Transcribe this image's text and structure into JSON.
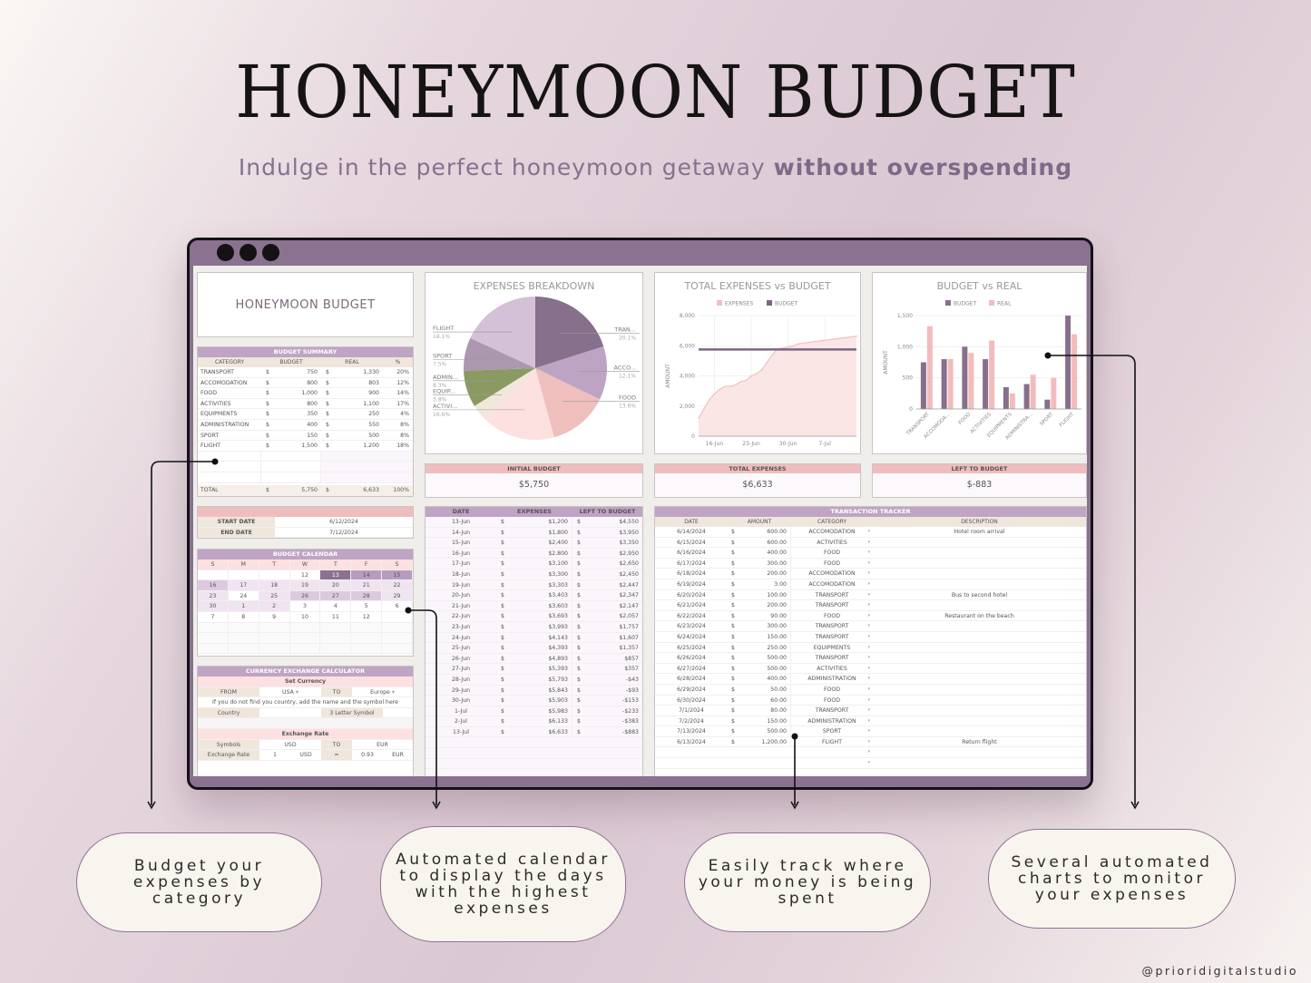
{
  "header": {
    "title": "HONEYMOON BUDGET",
    "subtitle_regular": "Indulge in the perfect honeymoon getaway ",
    "subtitle_bold": "without overspending"
  },
  "sheet": {
    "app_title": "HONEYMOON BUDGET",
    "budget_summary": {
      "title": "BUDGET SUMMARY",
      "columns": [
        "CATEGORY",
        "BUDGET",
        "REAL",
        "%"
      ],
      "currency": "$",
      "rows": [
        {
          "category": "TRANSPORT",
          "budget": "750",
          "real": "1,330",
          "pct": "20%"
        },
        {
          "category": "ACCOMODATION",
          "budget": "800",
          "real": "803",
          "pct": "12%"
        },
        {
          "category": "FOOD",
          "budget": "1,000",
          "real": "900",
          "pct": "14%"
        },
        {
          "category": "ACTIVITIES",
          "budget": "800",
          "real": "1,100",
          "pct": "17%"
        },
        {
          "category": "EQUIPMENTS",
          "budget": "350",
          "real": "250",
          "pct": "4%"
        },
        {
          "category": "ADMINISTRATION",
          "budget": "400",
          "real": "550",
          "pct": "8%"
        },
        {
          "category": "SPORT",
          "budget": "150",
          "real": "500",
          "pct": "8%"
        },
        {
          "category": "FLIGHT",
          "budget": "1,500",
          "real": "1,200",
          "pct": "18%"
        }
      ],
      "total": {
        "label": "TOTAL",
        "budget": "5,750",
        "real": "6,633",
        "pct": "100%"
      }
    },
    "dates": {
      "start_label": "START DATE",
      "start_value": "6/12/2024",
      "end_label": "END DATE",
      "end_value": "7/12/2024"
    },
    "calendar": {
      "title": "BUDGET CALENDAR",
      "weekdays": [
        "S",
        "M",
        "T",
        "W",
        "T",
        "F",
        "S"
      ],
      "weeks": [
        [
          "",
          "",
          "",
          "12",
          "13",
          "14",
          "15"
        ],
        [
          "16",
          "17",
          "18",
          "19",
          "20",
          "21",
          "22"
        ],
        [
          "23",
          "24",
          "25",
          "26",
          "27",
          "28",
          "29"
        ],
        [
          "30",
          "1",
          "2",
          "3",
          "4",
          "5",
          "6"
        ],
        [
          "7",
          "8",
          "9",
          "10",
          "11",
          "12",
          ""
        ]
      ],
      "intensity": [
        [
          0,
          0,
          0,
          0,
          4,
          3,
          3
        ],
        [
          2,
          1,
          1,
          1,
          1,
          1,
          1
        ],
        [
          1,
          0,
          1,
          2,
          2,
          2,
          1
        ],
        [
          1,
          1,
          1,
          0,
          0,
          0,
          0
        ],
        [
          0,
          0,
          0,
          0,
          0,
          0,
          0
        ]
      ],
      "colors": [
        "#ffffff",
        "#efe4f0",
        "#ddc9df",
        "#b89cbf",
        "#8a7290"
      ]
    },
    "currency_calc": {
      "title": "CURRENCY EXCHANGE CALCULATOR",
      "set_currency": "Set Currency",
      "from_label": "FROM",
      "from_value": "USA",
      "to_label": "TO",
      "to_value": "Europe",
      "note": "If you do not find you country, add the name and the symbol here",
      "country_label": "Country",
      "symbol_label": "3 Letter Symbol",
      "exchange_rate_title": "Exchange Rate",
      "symbols_label": "Symbols",
      "symbol_from": "USD",
      "symbol_to_label": "TO",
      "symbol_to": "EUR",
      "rate_label": "Exchange Rate",
      "rate_amount": "1",
      "rate_from": "USD",
      "rate_eq": "=",
      "rate_value": "0.93",
      "rate_to": "EUR"
    },
    "kpis": [
      {
        "label": "INITIAL BUDGET",
        "value": "$5,750"
      },
      {
        "label": "TOTAL EXPENSES",
        "value": "$6,633"
      },
      {
        "label": "LEFT TO BUDGET",
        "value": "$-883"
      }
    ],
    "daily": {
      "columns": [
        "DATE",
        "EXPENSES",
        "LEFT TO BUDGET"
      ],
      "currency": "$",
      "rows": [
        [
          "13-Jun",
          "$1,200",
          "$4,550"
        ],
        [
          "14-Jun",
          "$1,800",
          "$3,950"
        ],
        [
          "15-Jun",
          "$2,400",
          "$3,350"
        ],
        [
          "16-Jun",
          "$2,800",
          "$2,950"
        ],
        [
          "17-Jun",
          "$3,100",
          "$2,650"
        ],
        [
          "18-Jun",
          "$3,300",
          "$2,450"
        ],
        [
          "19-Jun",
          "$3,303",
          "$2,447"
        ],
        [
          "20-Jun",
          "$3,403",
          "$2,347"
        ],
        [
          "21-Jun",
          "$3,603",
          "$2,147"
        ],
        [
          "22-Jun",
          "$3,693",
          "$2,057"
        ],
        [
          "23-Jun",
          "$3,993",
          "$1,757"
        ],
        [
          "24-Jun",
          "$4,143",
          "$1,607"
        ],
        [
          "25-Jun",
          "$4,393",
          "$1,357"
        ],
        [
          "26-Jun",
          "$4,893",
          "$857"
        ],
        [
          "27-Jun",
          "$5,393",
          "$357"
        ],
        [
          "28-Jun",
          "$5,793",
          "-$43"
        ],
        [
          "29-Jun",
          "$5,843",
          "-$93"
        ],
        [
          "30-Jun",
          "$5,903",
          "-$153"
        ],
        [
          "1-Jul",
          "$5,983",
          "-$233"
        ],
        [
          "2-Jul",
          "$6,133",
          "-$383"
        ],
        [
          "13-Jul",
          "$6,633",
          "-$883"
        ]
      ]
    },
    "tracker": {
      "title": "TRANSACTION TRACKER",
      "columns": [
        "DATE",
        "AMOUNT",
        "CATEGORY",
        "DESCRIPTION"
      ],
      "currency": "$",
      "rows": [
        [
          "6/14/2024",
          "600.00",
          "ACCOMODATION",
          "Hotel room arrival"
        ],
        [
          "6/15/2024",
          "600.00",
          "ACTIVITIES",
          ""
        ],
        [
          "6/16/2024",
          "400.00",
          "FOOD",
          ""
        ],
        [
          "6/17/2024",
          "300.00",
          "FOOD",
          ""
        ],
        [
          "6/18/2024",
          "200.00",
          "ACCOMODATION",
          ""
        ],
        [
          "6/19/2024",
          "3.00",
          "ACCOMODATION",
          ""
        ],
        [
          "6/20/2024",
          "100.00",
          "TRANSPORT",
          "Bus to second hotel"
        ],
        [
          "6/21/2024",
          "200.00",
          "TRANSPORT",
          ""
        ],
        [
          "6/22/2024",
          "90.00",
          "FOOD",
          "Restaurant on the beach"
        ],
        [
          "6/23/2024",
          "300.00",
          "TRANSPORT",
          ""
        ],
        [
          "6/24/2024",
          "150.00",
          "TRANSPORT",
          ""
        ],
        [
          "6/25/2024",
          "250.00",
          "EQUIPMENTS",
          ""
        ],
        [
          "6/26/2024",
          "500.00",
          "TRANSPORT",
          ""
        ],
        [
          "6/27/2024",
          "500.00",
          "ACTIVITIES",
          ""
        ],
        [
          "6/28/2024",
          "400.00",
          "ADMINISTRATION",
          ""
        ],
        [
          "6/29/2024",
          "50.00",
          "FOOD",
          ""
        ],
        [
          "6/30/2024",
          "60.00",
          "FOOD",
          ""
        ],
        [
          "7/1/2024",
          "80.00",
          "TRANSPORT",
          ""
        ],
        [
          "7/2/2024",
          "150.00",
          "ADMINISTRATION",
          ""
        ],
        [
          "7/13/2024",
          "500.00",
          "SPORT",
          ""
        ],
        [
          "6/13/2024",
          "1,200.00",
          "FLIGHT",
          "Return flight"
        ]
      ]
    }
  },
  "chart_data": [
    {
      "type": "pie",
      "title": "EXPENSES BREAKDOWN",
      "categories": [
        "TRAN...",
        "ACCO...",
        "FOOD",
        "ACTIVI...",
        "EQUIP...",
        "ADMIN...",
        "SPORT",
        "FLIGHT"
      ],
      "values": [
        20.1,
        12.1,
        13.6,
        16.6,
        3.8,
        8.3,
        7.5,
        18.1
      ],
      "labels": [
        "20.1%",
        "12.1%",
        "13.6%",
        "16.6%",
        "3.8%",
        "8.3%",
        "7.5%",
        "18.1%"
      ],
      "colors": [
        "#87708c",
        "#bea4c4",
        "#efbfbd",
        "#fde0e0",
        "#f1e8dd",
        "#8b9a62",
        "#ab98ae",
        "#d4c0d7"
      ]
    },
    {
      "type": "area",
      "title": "TOTAL EXPENSES vs BUDGET",
      "xlabel": "",
      "ylabel": "AMOUNT",
      "ylim": [
        0,
        8000
      ],
      "yticks": [
        "0",
        "2,000",
        "4,000",
        "6,000",
        "8,000"
      ],
      "xticks": [
        "16-Jun",
        "23-Jun",
        "30-Jun",
        "7-Jul"
      ],
      "x_days": [
        0,
        1,
        2,
        3,
        4,
        5,
        6,
        7,
        8,
        9,
        10,
        11,
        12,
        13,
        14,
        15,
        16,
        17,
        18,
        19,
        30
      ],
      "xtick_days": [
        3,
        10,
        17,
        24
      ],
      "x_max_day": 30,
      "series": [
        {
          "name": "EXPENSES",
          "color": "#f2c0c0",
          "values": [
            1200,
            1800,
            2400,
            2800,
            3100,
            3300,
            3303,
            3403,
            3603,
            3693,
            3993,
            4143,
            4393,
            4893,
            5393,
            5793,
            5843,
            5903,
            5983,
            6133,
            6633
          ]
        },
        {
          "name": "BUDGET",
          "color": "#7d6583",
          "values": [
            5750
          ]
        }
      ],
      "legend": "top"
    },
    {
      "type": "bar",
      "title": "BUDGET vs REAL",
      "ylabel": "AMOUNT",
      "ylim": [
        0,
        1500
      ],
      "yticks": [
        "0",
        "500",
        "1,000",
        "1,500"
      ],
      "categories": [
        "TRANSPORT",
        "ACCOMODA...",
        "FOOD",
        "ACTIVITIES",
        "EQUIPMENTS",
        "ADMINISTRA...",
        "SPORT",
        "FLIGHT"
      ],
      "series": [
        {
          "name": "BUDGET",
          "color": "#876f8c",
          "values": [
            750,
            800,
            1000,
            800,
            350,
            400,
            150,
            1500
          ]
        },
        {
          "name": "REAL",
          "color": "#f2bcbc",
          "values": [
            1330,
            803,
            900,
            1100,
            250,
            550,
            500,
            1200
          ]
        }
      ],
      "legend": "top"
    }
  ],
  "features": [
    {
      "text": "Budget your expenses by category"
    },
    {
      "text": "Automated calendar to display the days with the highest expenses"
    },
    {
      "text": "Easily track where your money is being spent"
    },
    {
      "text": "Several automated charts to monitor your expenses"
    }
  ],
  "credit": "@prioridigitalstudio"
}
